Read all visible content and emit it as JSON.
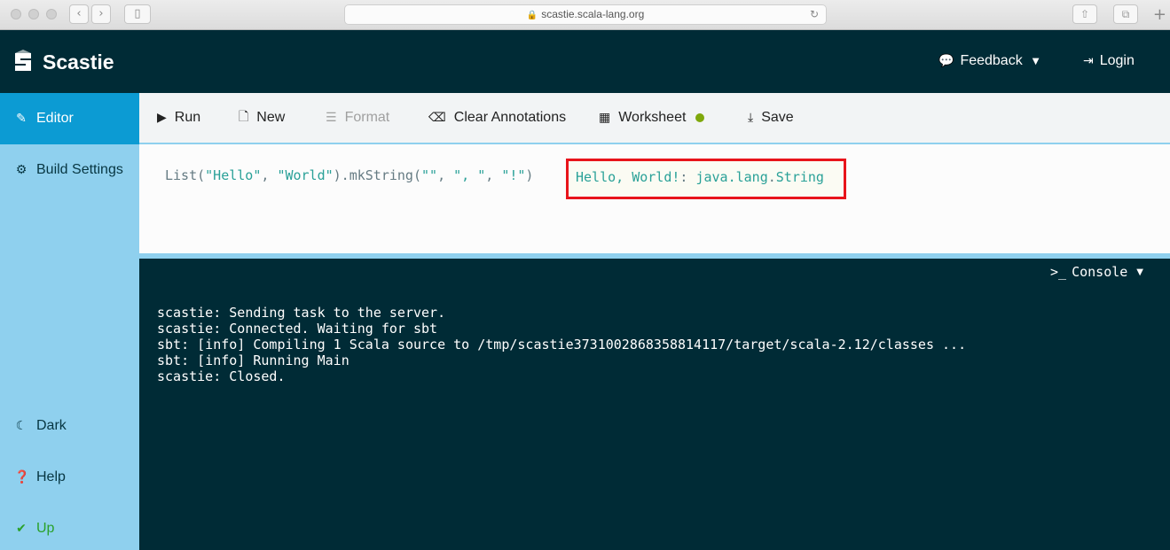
{
  "browser": {
    "url": "scastie.scala-lang.org",
    "lock_icon": "lock-icon",
    "reload_icon": "reload-icon"
  },
  "header": {
    "app_name": "Scastie",
    "logo_icon": "scastie-logo-icon",
    "feedback_label": "Feedback",
    "login_label": "Login"
  },
  "sidebar": {
    "items": [
      {
        "label": "Editor",
        "icon": "edit-icon",
        "active": true
      },
      {
        "label": "Build Settings",
        "icon": "gear-icon",
        "active": false
      },
      {
        "label": "Dark",
        "icon": "moon-icon",
        "active": false
      },
      {
        "label": "Help",
        "icon": "question-circle-icon",
        "active": false
      },
      {
        "label": "Up",
        "icon": "check-circle-icon",
        "active": false
      }
    ]
  },
  "toolbar": {
    "run_label": "Run",
    "new_label": "New",
    "format_label": "Format",
    "clear_annotations_label": "Clear Annotations",
    "worksheet_label": "Worksheet",
    "save_label": "Save",
    "worksheet_status_color": "#7fa80c"
  },
  "editor": {
    "code_prefix": "List(",
    "code_str1": "\"Hello\"",
    "code_sep1": ", ",
    "code_str2": "\"World\"",
    "code_mid": ").mkString(",
    "code_str3": "\"\"",
    "code_sep2": ", ",
    "code_str4": "\", \"",
    "code_sep3": ", ",
    "code_str5": "\"!\"",
    "code_suffix": ")",
    "annotation_value": "Hello, World!",
    "annotation_sep": ": ",
    "annotation_type_pkg": "java.lang",
    "annotation_dot": ".",
    "annotation_type_name": "String",
    "annotation_highlight_color": "#e8141b"
  },
  "console": {
    "toggle_label": "Console",
    "toggle_prompt": ">_",
    "lines": [
      "scastie: Sending task to the server.",
      "scastie: Connected. Waiting for sbt",
      "sbt: [info] Compiling 1 Scala source to /tmp/scastie3731002868358814117/target/scala-2.12/classes ...",
      "sbt: [info] Running Main",
      "scastie: Closed."
    ]
  },
  "colors": {
    "header_bg": "#002b36",
    "sidebar_bg": "#8fd0ee",
    "sidebar_active": "#0c9bd3",
    "status_up": "#2aa12a"
  }
}
